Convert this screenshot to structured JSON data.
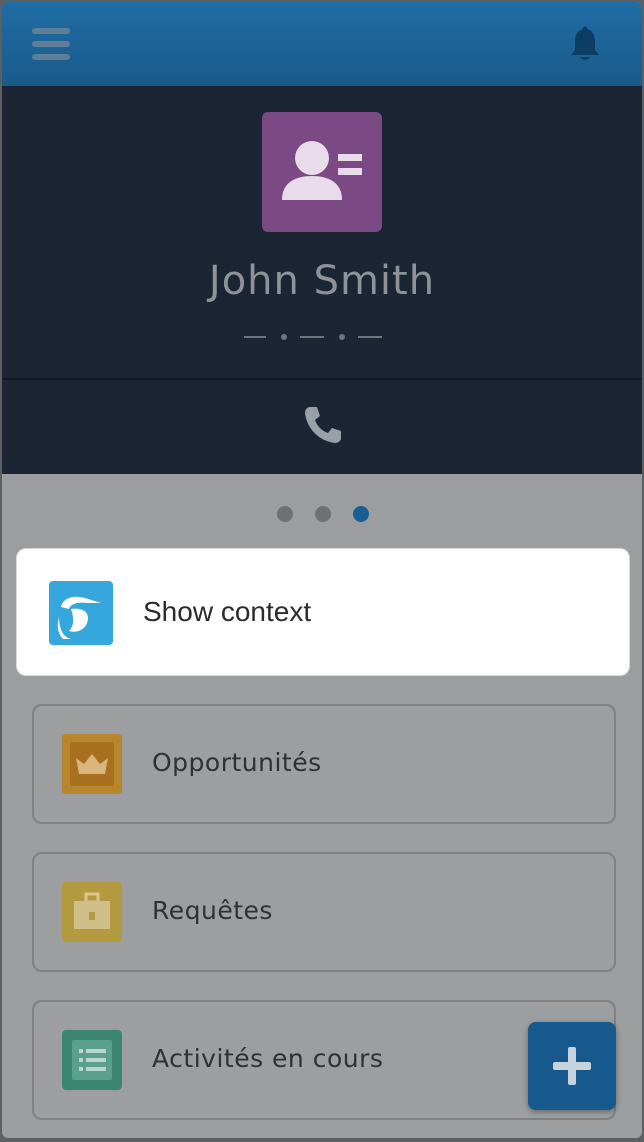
{
  "contact": {
    "name": "John Smith"
  },
  "pager": {
    "count": 3,
    "active_index": 2
  },
  "context_action": {
    "label": "Show context"
  },
  "related_lists": [
    {
      "label": "Opportunités",
      "icon": "crown-icon",
      "color": "#b8862c"
    },
    {
      "label": "Requêtes",
      "icon": "briefcase-icon",
      "color": "#b39a3e"
    },
    {
      "label": "Activités en cours",
      "icon": "list-icon",
      "color": "#3c8670"
    }
  ],
  "colors": {
    "topbar": "#1f6da5",
    "header": "#1b2533",
    "contact_tile": "#7b4a84",
    "context_icon": "#35a7dd",
    "fab": "#17598d"
  }
}
